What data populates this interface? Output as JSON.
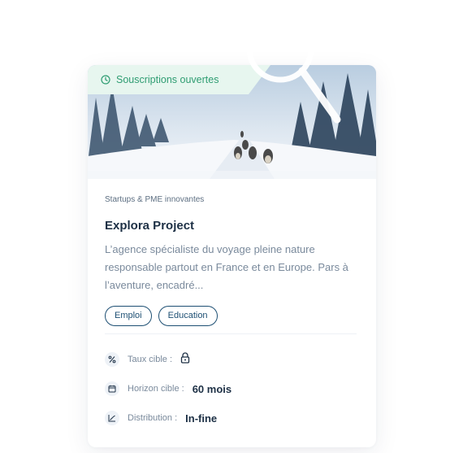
{
  "card": {
    "status": "Souscriptions ouvertes",
    "category": "Startups & PME innovantes",
    "title": "Explora Project",
    "description": "L’agence spécialiste du voyage pleine nature responsable partout en France et en Europe. Pars à l’aventure, encadré...",
    "tags": [
      "Emploi",
      "Education"
    ],
    "metrics": [
      {
        "label": "Taux cible :",
        "value": "",
        "icon": "percent-icon",
        "value_icon": "lock-icon"
      },
      {
        "label": "Horizon cible :",
        "value": "60 mois",
        "icon": "calendar-icon"
      },
      {
        "label": "Distribution :",
        "value": "In-fine",
        "icon": "chart-trend-icon"
      }
    ]
  },
  "colors": {
    "status_green": "#2f9d72",
    "status_bg": "#e7f6ef",
    "title": "#1d3045",
    "tag_border": "#1d4f73",
    "text_muted": "#7a8a9c"
  }
}
